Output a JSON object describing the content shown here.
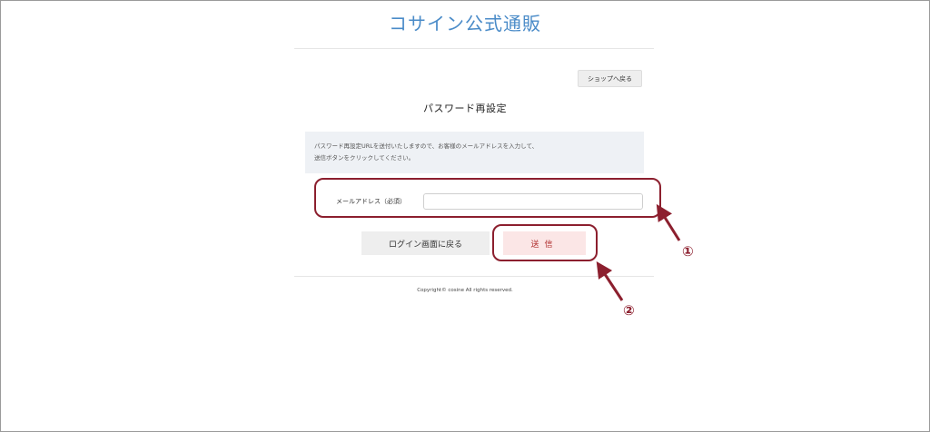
{
  "header": {
    "site_title": "コサイン公式通販"
  },
  "toolbar": {
    "back_to_shop_label": "ショップへ戻る"
  },
  "page": {
    "heading": "パスワード再設定"
  },
  "notice": {
    "line1": "パスワード再設定URLを送付いたしますので、お客様のメールアドレスを入力して、",
    "line2": "送信ボタンをクリックしてください。"
  },
  "form": {
    "email_label": "メールアドレス（必須）",
    "email_value": "",
    "email_placeholder": ""
  },
  "actions": {
    "back_to_login_label": "ログイン画面に戻る",
    "submit_label": "送信"
  },
  "footer": {
    "copyright": "Copyright© cosine All rights reserved."
  },
  "annotations": {
    "marker_1": "①",
    "marker_2": "②",
    "color": "#8c1f2e"
  }
}
